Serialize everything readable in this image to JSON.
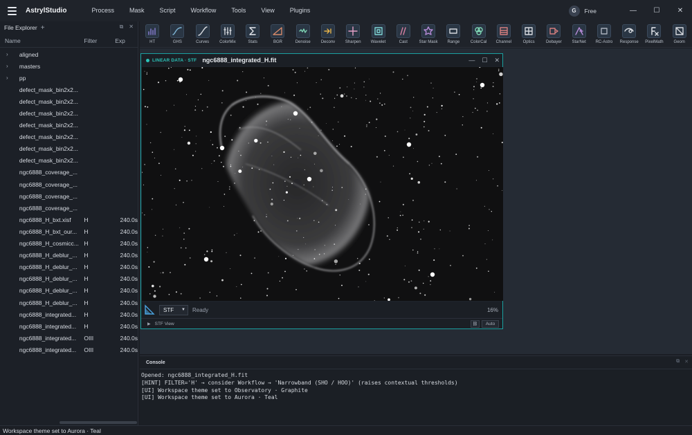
{
  "app": {
    "name": "AstrylStudio",
    "menu": [
      "Process",
      "Mask",
      "Script",
      "Workflow",
      "Tools",
      "View",
      "Plugins"
    ],
    "avatar_initial": "G",
    "plan": "Free",
    "window_controls": [
      "—",
      "☐",
      "✕"
    ]
  },
  "file_explorer": {
    "title": "File Explorer",
    "add_glyph": "+",
    "columns": {
      "name": "Name",
      "filter": "Filter",
      "exp": "Exp"
    },
    "rows": [
      {
        "chev": "›",
        "name": "aligned",
        "filter": "",
        "exp": ""
      },
      {
        "chev": "›",
        "name": "masters",
        "filter": "",
        "exp": ""
      },
      {
        "chev": "›",
        "name": "pp",
        "filter": "",
        "exp": ""
      },
      {
        "chev": "",
        "name": "defect_mask_bin2x2...",
        "filter": "",
        "exp": ""
      },
      {
        "chev": "",
        "name": "defect_mask_bin2x2...",
        "filter": "",
        "exp": ""
      },
      {
        "chev": "",
        "name": "defect_mask_bin2x2...",
        "filter": "",
        "exp": ""
      },
      {
        "chev": "",
        "name": "defect_mask_bin2x2...",
        "filter": "",
        "exp": ""
      },
      {
        "chev": "",
        "name": "defect_mask_bin2x2...",
        "filter": "",
        "exp": ""
      },
      {
        "chev": "",
        "name": "defect_mask_bin2x2...",
        "filter": "",
        "exp": ""
      },
      {
        "chev": "",
        "name": "defect_mask_bin2x2...",
        "filter": "",
        "exp": ""
      },
      {
        "chev": "",
        "name": "ngc6888_coverage_...",
        "filter": "",
        "exp": ""
      },
      {
        "chev": "",
        "name": "ngc6888_coverage_...",
        "filter": "",
        "exp": ""
      },
      {
        "chev": "",
        "name": "ngc6888_coverage_...",
        "filter": "",
        "exp": ""
      },
      {
        "chev": "",
        "name": "ngc6888_coverage_...",
        "filter": "",
        "exp": ""
      },
      {
        "chev": "",
        "name": "ngc6888_H_bxt.xisf",
        "filter": "H",
        "exp": "240.0s"
      },
      {
        "chev": "",
        "name": "ngc6888_H_bxt_our...",
        "filter": "H",
        "exp": "240.0s"
      },
      {
        "chev": "",
        "name": "ngc6888_H_cosmicc...",
        "filter": "H",
        "exp": "240.0s"
      },
      {
        "chev": "",
        "name": "ngc6888_H_deblur_...",
        "filter": "H",
        "exp": "240.0s"
      },
      {
        "chev": "",
        "name": "ngc6888_H_deblur_...",
        "filter": "H",
        "exp": "240.0s"
      },
      {
        "chev": "",
        "name": "ngc6888_H_deblur_...",
        "filter": "H",
        "exp": "240.0s"
      },
      {
        "chev": "",
        "name": "ngc6888_H_deblur_...",
        "filter": "H",
        "exp": "240.0s"
      },
      {
        "chev": "",
        "name": "ngc6888_H_deblur_...",
        "filter": "H",
        "exp": "240.0s"
      },
      {
        "chev": "",
        "name": "ngc6888_integrated...",
        "filter": "H",
        "exp": "240.0s"
      },
      {
        "chev": "",
        "name": "ngc6888_integrated...",
        "filter": "H",
        "exp": "240.0s"
      },
      {
        "chev": "",
        "name": "ngc6888_integrated...",
        "filter": "OIII",
        "exp": "240.0s"
      },
      {
        "chev": "",
        "name": "ngc6888_integrated...",
        "filter": "OIII",
        "exp": "240.0s"
      }
    ]
  },
  "toolbar": {
    "tools": [
      {
        "label": "HT",
        "icon": "histogram-icon",
        "color": "#8a7fd6"
      },
      {
        "label": "GHS",
        "icon": "ghs-curve-icon",
        "color": "#7fb5d6"
      },
      {
        "label": "Curves",
        "icon": "curves-icon",
        "color": "#d6d9de"
      },
      {
        "label": "ColorMix",
        "icon": "colormix-icon",
        "color": "#d6d9de"
      },
      {
        "label": "Stats",
        "icon": "sigma-icon",
        "color": "#e6e9ee"
      },
      {
        "label": "BGR",
        "icon": "gradient-icon",
        "color": "#d68a6a"
      },
      {
        "label": "Denoise",
        "icon": "denoise-icon",
        "color": "#7fd6b5"
      },
      {
        "label": "Deconv",
        "icon": "deconv-icon",
        "color": "#e6b34a"
      },
      {
        "label": "Sharpen",
        "icon": "sharpen-icon",
        "color": "#e6a1c8"
      },
      {
        "label": "Wavelet",
        "icon": "wavelet-icon",
        "color": "#7fd6d6"
      },
      {
        "label": "Cast",
        "icon": "cast-icon",
        "color": "#d67fa0"
      },
      {
        "label": "Star Mask",
        "icon": "star-mask-icon",
        "color": "#b58ad6"
      },
      {
        "label": "Range",
        "icon": "range-icon",
        "color": "#d6d9de"
      },
      {
        "label": "ColorCal",
        "icon": "colorcal-icon",
        "color": "#7fd6b5"
      },
      {
        "label": "Channel",
        "icon": "channel-icon",
        "color": "#d67f7f"
      },
      {
        "label": "Optics",
        "icon": "optics-icon",
        "color": "#d6d9de"
      },
      {
        "label": "Debayer",
        "icon": "debayer-icon",
        "color": "#d67f7f"
      },
      {
        "label": "StarNet",
        "icon": "starnet-icon",
        "color": "#b58ad6"
      },
      {
        "label": "RC-Astro",
        "icon": "rc-astro-icon",
        "color": "#aab1bc"
      },
      {
        "label": "Response",
        "icon": "response-icon",
        "color": "#d6d9de"
      },
      {
        "label": "PixelMath",
        "icon": "pixelmath-icon",
        "color": "#e6e9ee"
      },
      {
        "label": "Geom",
        "icon": "geometry-icon",
        "color": "#d6d9de"
      }
    ]
  },
  "image_window": {
    "mode_label": "LINEAR DATA · STF",
    "title": "ngc6888_integrated_H.fit",
    "stf_option": "STF",
    "status": "Ready",
    "zoom": "16%",
    "stf_view_label": "STF View",
    "auto_label": "Auto"
  },
  "console": {
    "title": "Console",
    "lines": [
      "Opened: ngc6888_integrated_H.fit",
      "[HINT] FILTER='H' → consider Workflow → 'Narrowband (SHO / HOO)' (raises contextual thresholds)",
      "[UI] Workspace theme set to Observatory · Graphite",
      "[UI] Workspace theme set to Aurora · Teal"
    ]
  },
  "statusbar": {
    "text": "Workspace theme set to Aurora · Teal"
  }
}
